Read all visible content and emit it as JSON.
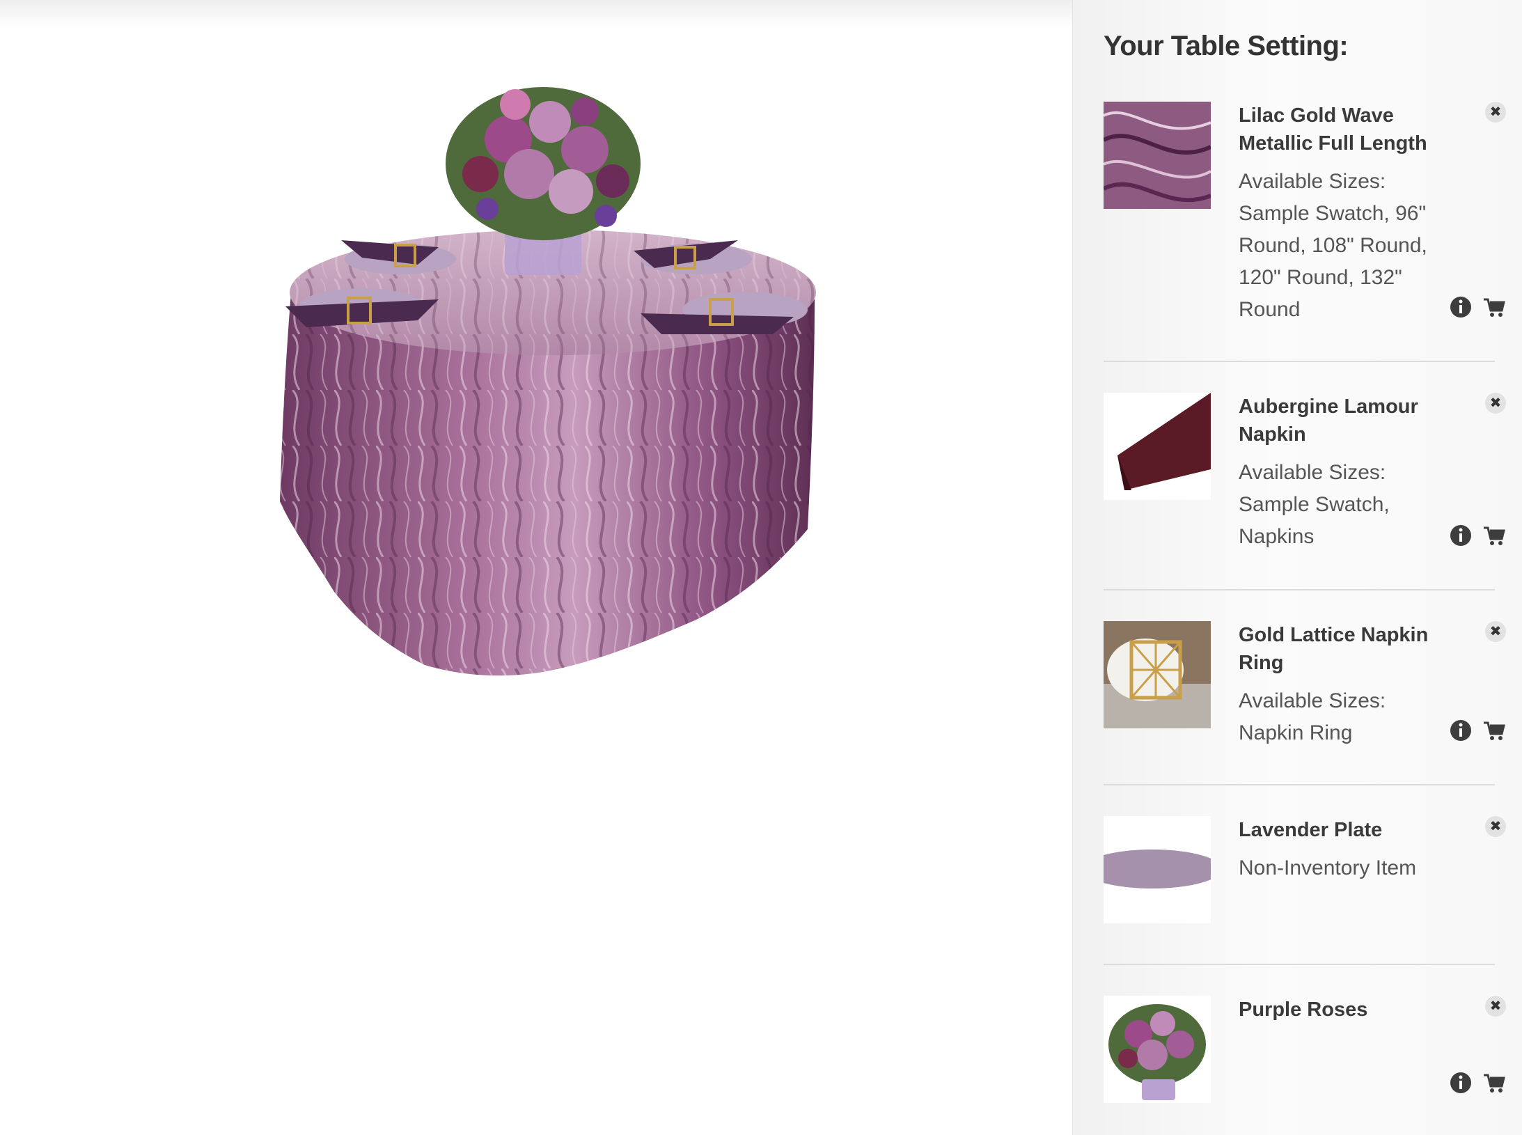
{
  "sidebar": {
    "title": "Your Table Setting:",
    "items": [
      {
        "name": "Lilac Gold Wave Metallic Full Length",
        "sizes_label": "Available Sizes:",
        "sizes": "Sample Swatch, 96\" Round, 108\" Round, 120\" Round, 132\" Round",
        "thumb": "lilac-wave-fabric",
        "has_actions": true
      },
      {
        "name": "Aubergine Lamour Napkin",
        "sizes_label": "Available Sizes:",
        "sizes": "Sample Swatch, Napkins",
        "thumb": "aubergine-napkin",
        "has_actions": true
      },
      {
        "name": "Gold Lattice Napkin Ring",
        "sizes_label": "Available Sizes:",
        "sizes": "Napkin Ring",
        "thumb": "gold-lattice-ring",
        "has_actions": true
      },
      {
        "name": "Lavender Plate",
        "note": "Non-Inventory Item",
        "thumb": "lavender-plate",
        "has_actions": false
      },
      {
        "name": "Purple Roses",
        "thumb": "purple-roses",
        "has_actions": true
      }
    ],
    "icons": {
      "remove": "close-icon",
      "info": "info-icon",
      "cart": "cart-icon"
    }
  },
  "colors": {
    "tablecloth": "#8b4f7c",
    "plate": "#b8a3c2",
    "napkin": "#4a2a4e",
    "flowers": "#9c4a8a"
  }
}
